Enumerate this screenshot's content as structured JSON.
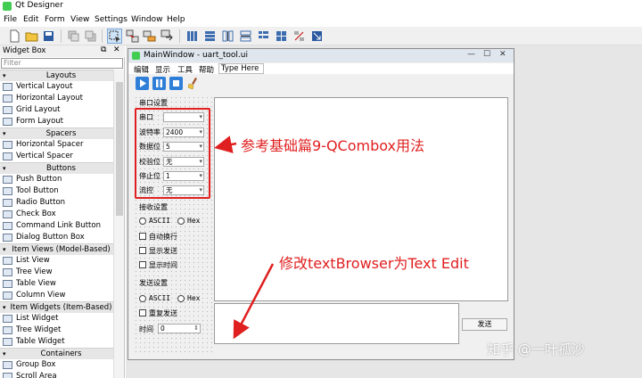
{
  "app": {
    "title": "Qt Designer"
  },
  "menubar": [
    "File",
    "Edit",
    "Form",
    "View",
    "Settings",
    "Window",
    "Help"
  ],
  "widget_box": {
    "title": "Widget Box",
    "filter_placeholder": "Filter",
    "rows": [
      {
        "kind": "cat",
        "label": "Layouts"
      },
      {
        "kind": "item",
        "label": "Vertical Layout",
        "icon": "vertical-layout-icon"
      },
      {
        "kind": "item",
        "label": "Horizontal Layout",
        "icon": "horizontal-layout-icon"
      },
      {
        "kind": "item",
        "label": "Grid Layout",
        "icon": "grid-layout-icon"
      },
      {
        "kind": "item",
        "label": "Form Layout",
        "icon": "form-layout-icon"
      },
      {
        "kind": "cat",
        "label": "Spacers"
      },
      {
        "kind": "item",
        "label": "Horizontal Spacer",
        "icon": "horizontal-spacer-icon"
      },
      {
        "kind": "item",
        "label": "Vertical Spacer",
        "icon": "vertical-spacer-icon"
      },
      {
        "kind": "cat",
        "label": "Buttons"
      },
      {
        "kind": "item",
        "label": "Push Button",
        "icon": "push-button-icon"
      },
      {
        "kind": "item",
        "label": "Tool Button",
        "icon": "tool-button-icon"
      },
      {
        "kind": "item",
        "label": "Radio Button",
        "icon": "radio-button-icon"
      },
      {
        "kind": "item",
        "label": "Check Box",
        "icon": "check-box-icon"
      },
      {
        "kind": "item",
        "label": "Command Link Button",
        "icon": "command-link-icon"
      },
      {
        "kind": "item",
        "label": "Dialog Button Box",
        "icon": "dialog-button-box-icon"
      },
      {
        "kind": "cat",
        "label": "Item Views (Model-Based)"
      },
      {
        "kind": "item",
        "label": "List View",
        "icon": "list-view-icon"
      },
      {
        "kind": "item",
        "label": "Tree View",
        "icon": "tree-view-icon"
      },
      {
        "kind": "item",
        "label": "Table View",
        "icon": "table-view-icon"
      },
      {
        "kind": "item",
        "label": "Column View",
        "icon": "column-view-icon"
      },
      {
        "kind": "cat",
        "label": "Item Widgets (Item-Based)"
      },
      {
        "kind": "item",
        "label": "List Widget",
        "icon": "list-widget-icon"
      },
      {
        "kind": "item",
        "label": "Tree Widget",
        "icon": "tree-widget-icon"
      },
      {
        "kind": "item",
        "label": "Table Widget",
        "icon": "table-widget-icon"
      },
      {
        "kind": "cat",
        "label": "Containers"
      },
      {
        "kind": "item",
        "label": "Group Box",
        "icon": "group-box-icon"
      },
      {
        "kind": "item",
        "label": "Scroll Area",
        "icon": "scroll-area-icon"
      }
    ]
  },
  "form": {
    "title": "MainWindow - uart_tool.ui",
    "menu": [
      "编辑",
      "显示",
      "工具",
      "帮助"
    ],
    "type_here": "Type Here",
    "serial_group": "串口设置",
    "fields": [
      {
        "label": "串口",
        "value": ""
      },
      {
        "label": "波特率",
        "value": "2400"
      },
      {
        "label": "数据位",
        "value": "5"
      },
      {
        "label": "校验位",
        "value": "无"
      },
      {
        "label": "停止位",
        "value": "1"
      },
      {
        "label": "流控",
        "value": "无"
      }
    ],
    "recv_group": "接收设置",
    "recv_radio": [
      "ASCII",
      "Hex"
    ],
    "recv_checks": [
      "自动换行",
      "显示发送",
      "显示时间"
    ],
    "send_group": "发送设置",
    "send_radio": [
      "ASCII",
      "Hex"
    ],
    "send_check": "重复发送",
    "interval_label": "时间",
    "interval_value": "0",
    "send_button": "发送"
  },
  "annotations": {
    "combobox_note": "参考基础篇9-QCombox用法",
    "textedit_note": "修改textBrowser为Text Edit",
    "highlight_color": "#e02020"
  },
  "watermark": "知乎 @一叶孤沙"
}
